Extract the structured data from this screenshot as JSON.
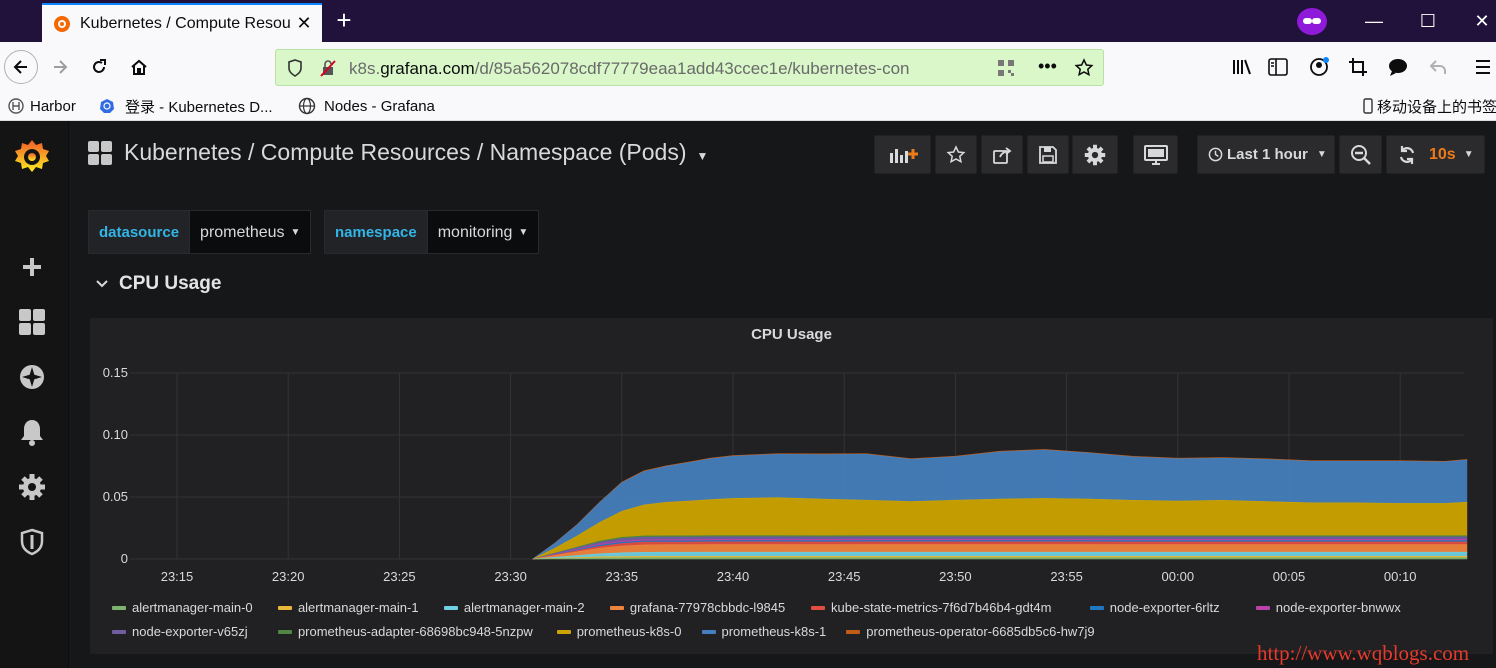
{
  "browser": {
    "tab_title": "Kubernetes / Compute Resou",
    "url_prefix": "k8s.",
    "url_domain": "grafana.com",
    "url_path": "/d/85a562078cdf77779eaa1add43ccec1e/kubernetes-con",
    "window_controls": {
      "minimize": "—",
      "maximize": "☐",
      "close": "✕"
    },
    "bookmarks": [
      {
        "label": "Harbor"
      },
      {
        "label": "登录 - Kubernetes D..."
      },
      {
        "label": "Nodes - Grafana"
      }
    ],
    "mobile_bookmarks": "移动设备上的书签"
  },
  "dashboard": {
    "title": "Kubernetes / Compute Resources / Namespace (Pods)",
    "time_range": "Last 1 hour",
    "refresh": "10s",
    "variables": [
      {
        "label": "datasource",
        "value": "prometheus"
      },
      {
        "label": "namespace",
        "value": "monitoring"
      }
    ],
    "row_title": "CPU Usage",
    "accent_color": "#33b5e5",
    "refresh_color": "#eb7b18"
  },
  "chart_data": {
    "type": "area",
    "stacked": true,
    "title": "CPU Usage",
    "ylim": [
      0,
      0.15
    ],
    "y_ticks": [
      "0.15",
      "0.10",
      "0.05",
      "0"
    ],
    "x_ticks": [
      "23:15",
      "23:20",
      "23:25",
      "23:30",
      "23:35",
      "23:40",
      "23:45",
      "23:50",
      "23:55",
      "00:00",
      "00:05",
      "00:10"
    ],
    "grid": true,
    "legend_position": "bottom",
    "x": [
      "23:31",
      "23:32",
      "23:33",
      "23:34",
      "23:35",
      "23:36",
      "23:37",
      "23:38",
      "23:39",
      "23:40",
      "23:42",
      "23:44",
      "23:46",
      "23:48",
      "23:50",
      "23:52",
      "23:54",
      "23:56",
      "23:58",
      "00:00",
      "00:02",
      "00:04",
      "00:06",
      "00:08",
      "00:10",
      "00:12",
      "00:13"
    ],
    "series": [
      {
        "name": "alertmanager-main-0",
        "color": "#7eb26d",
        "values": [
          0,
          0.0003,
          0.0006,
          0.0009,
          0.001,
          0.0011,
          0.0011,
          0.0011,
          0.0011,
          0.0011,
          0.0011,
          0.0011,
          0.0011,
          0.0011,
          0.0011,
          0.0011,
          0.0011,
          0.0011,
          0.0011,
          0.0011,
          0.0011,
          0.0011,
          0.0011,
          0.0011,
          0.0011,
          0.0011,
          0.0011
        ]
      },
      {
        "name": "alertmanager-main-1",
        "color": "#eab839",
        "values": [
          0,
          0.0003,
          0.0006,
          0.0009,
          0.001,
          0.0011,
          0.0011,
          0.0011,
          0.0011,
          0.0011,
          0.0011,
          0.0011,
          0.0011,
          0.0011,
          0.0011,
          0.0011,
          0.0011,
          0.0011,
          0.0011,
          0.0011,
          0.0011,
          0.0011,
          0.0011,
          0.0011,
          0.0011,
          0.0011,
          0.0011
        ]
      },
      {
        "name": "alertmanager-main-2",
        "color": "#6ed0e0",
        "values": [
          0,
          0.0008,
          0.0016,
          0.0024,
          0.003,
          0.0032,
          0.0033,
          0.0033,
          0.0033,
          0.0033,
          0.0033,
          0.0033,
          0.0033,
          0.0033,
          0.0033,
          0.0033,
          0.0033,
          0.0033,
          0.0033,
          0.0033,
          0.0033,
          0.0033,
          0.0033,
          0.0033,
          0.0033,
          0.0033,
          0.0033
        ]
      },
      {
        "name": "grafana-77978cbbdc-l9845",
        "color": "#ef843c",
        "values": [
          0,
          0.0015,
          0.003,
          0.0045,
          0.0055,
          0.006,
          0.006,
          0.006,
          0.0062,
          0.0062,
          0.0062,
          0.0061,
          0.0062,
          0.0062,
          0.0062,
          0.0062,
          0.0062,
          0.0062,
          0.0061,
          0.0061,
          0.0061,
          0.0061,
          0.0061,
          0.0061,
          0.0061,
          0.0061,
          0.0061
        ]
      },
      {
        "name": "kube-state-metrics-7f6d7b46b4-gdt4m",
        "color": "#e24d42",
        "values": [
          0,
          0.0005,
          0.001,
          0.0015,
          0.002,
          0.0022,
          0.0022,
          0.0022,
          0.0022,
          0.0022,
          0.0022,
          0.0022,
          0.0022,
          0.0022,
          0.0022,
          0.0022,
          0.0022,
          0.0022,
          0.0022,
          0.0022,
          0.0022,
          0.0022,
          0.0022,
          0.0022,
          0.0022,
          0.0022,
          0.0022
        ]
      },
      {
        "name": "node-exporter-6rltz",
        "color": "#1f78c1",
        "values": [
          0,
          0.0003,
          0.0006,
          0.0009,
          0.001,
          0.001,
          0.001,
          0.001,
          0.001,
          0.001,
          0.001,
          0.001,
          0.001,
          0.001,
          0.001,
          0.001,
          0.001,
          0.001,
          0.001,
          0.001,
          0.001,
          0.001,
          0.001,
          0.001,
          0.001,
          0.001,
          0.001
        ]
      },
      {
        "name": "node-exporter-bnwwx",
        "color": "#ba43a9",
        "values": [
          0,
          0.0003,
          0.0006,
          0.0009,
          0.001,
          0.001,
          0.001,
          0.001,
          0.001,
          0.001,
          0.001,
          0.001,
          0.001,
          0.001,
          0.001,
          0.001,
          0.001,
          0.001,
          0.001,
          0.001,
          0.001,
          0.001,
          0.001,
          0.001,
          0.001,
          0.001,
          0.001
        ]
      },
      {
        "name": "node-exporter-v65zj",
        "color": "#705da0",
        "values": [
          0,
          0.0005,
          0.001,
          0.0015,
          0.002,
          0.002,
          0.002,
          0.002,
          0.002,
          0.002,
          0.002,
          0.002,
          0.002,
          0.002,
          0.002,
          0.002,
          0.002,
          0.002,
          0.002,
          0.002,
          0.002,
          0.002,
          0.002,
          0.002,
          0.002,
          0.002,
          0.002
        ]
      },
      {
        "name": "prometheus-adapter-68698bc948-5nzpw",
        "color": "#508642",
        "values": [
          0,
          0.0003,
          0.0006,
          0.0009,
          0.001,
          0.001,
          0.001,
          0.001,
          0.001,
          0.001,
          0.001,
          0.001,
          0.001,
          0.001,
          0.001,
          0.001,
          0.001,
          0.001,
          0.001,
          0.001,
          0.001,
          0.001,
          0.001,
          0.001,
          0.001,
          0.001,
          0.001
        ]
      },
      {
        "name": "prometheus-k8s-0",
        "color": "#cca300",
        "values": [
          0,
          0.004,
          0.009,
          0.015,
          0.021,
          0.025,
          0.027,
          0.028,
          0.029,
          0.03,
          0.0305,
          0.0295,
          0.0285,
          0.0275,
          0.0285,
          0.0295,
          0.03,
          0.0295,
          0.0285,
          0.028,
          0.0285,
          0.0275,
          0.0265,
          0.0265,
          0.026,
          0.026,
          0.027
        ]
      },
      {
        "name": "prometheus-k8s-1",
        "color": "#447ebc",
        "values": [
          0,
          0.004,
          0.009,
          0.016,
          0.023,
          0.027,
          0.029,
          0.031,
          0.033,
          0.034,
          0.035,
          0.036,
          0.037,
          0.034,
          0.035,
          0.038,
          0.039,
          0.037,
          0.035,
          0.034,
          0.034,
          0.034,
          0.0335,
          0.0335,
          0.034,
          0.0335,
          0.034
        ]
      },
      {
        "name": "prometheus-operator-6685db5c6-hw7j9",
        "color": "#c15c17",
        "values": [
          0,
          0.0002,
          0.0003,
          0.0004,
          0.0005,
          0.0005,
          0.0005,
          0.0005,
          0.0005,
          0.0005,
          0.0005,
          0.0005,
          0.0005,
          0.0005,
          0.0005,
          0.0005,
          0.0005,
          0.0005,
          0.0005,
          0.0005,
          0.0005,
          0.0005,
          0.0005,
          0.0005,
          0.0005,
          0.0005,
          0.0005
        ]
      }
    ]
  },
  "watermark": "http://www.wqblogs.com"
}
